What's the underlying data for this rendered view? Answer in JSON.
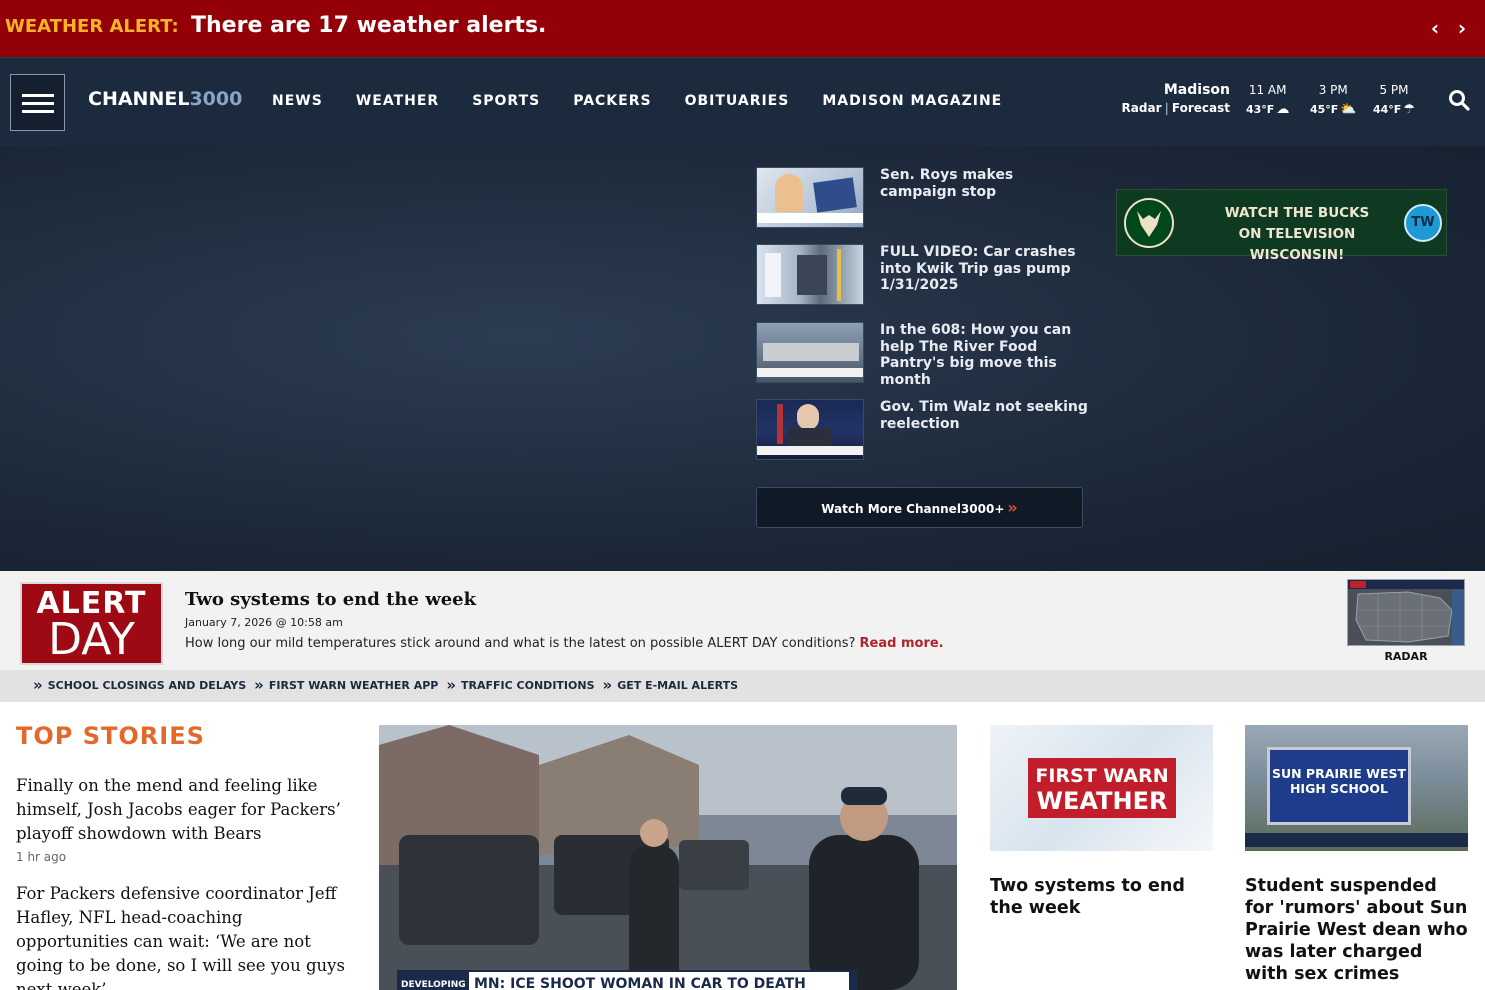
{
  "alert": {
    "label": "WEATHER ALERT:",
    "text": "There are 17 weather alerts.",
    "prev_icon": "‹",
    "next_icon": "›"
  },
  "nav": {
    "logo_part1": "CHANNEL",
    "logo_part2": "3000",
    "links": [
      "NEWS",
      "WEATHER",
      "SPORTS",
      "PACKERS",
      "OBITUARIES",
      "MADISON MAGAZINE"
    ],
    "weather": {
      "city": "Madison",
      "radar_link": "Radar",
      "forecast_link": "Forecast",
      "hours": [
        {
          "time": "11 AM",
          "temp": "43°F",
          "icon": "partly-cloudy-icon"
        },
        {
          "time": "3 PM",
          "temp": "45°F",
          "icon": "partly-sunny-icon"
        },
        {
          "time": "5 PM",
          "temp": "44°F",
          "icon": "rain-icon"
        }
      ]
    }
  },
  "videos": [
    {
      "title": "Sen. Roys makes campaign stop"
    },
    {
      "title": "FULL VIDEO: Car crashes into Kwik Trip gas pump 1/31/2025"
    },
    {
      "title": "In the 608: How you can help The River Food Pantry's big move this month"
    },
    {
      "title": "Gov. Tim Walz not seeking reelection"
    }
  ],
  "watch_more": {
    "label": "Watch More Channel3000+",
    "chevron": "»"
  },
  "ad": {
    "line1": "WATCH THE BUCKS",
    "line2": "ON TELEVISION WISCONSIN!",
    "badge": "TW"
  },
  "alertday": {
    "logo_line1": "ALERT",
    "logo_line2": "DAY",
    "title": "Two systems to end the week",
    "date": "January 7, 2026 @ 10:58 am",
    "desc": "How long our mild temperatures stick around and what is the latest on possible ALERT DAY conditions?",
    "read_more": "Read more.",
    "radar_label": "RADAR"
  },
  "quick_links": [
    "SCHOOL CLOSINGS AND DELAYS",
    "FIRST WARN WEATHER APP",
    "TRAFFIC CONDITIONS",
    "GET E-MAIL ALERTS"
  ],
  "top_stories": {
    "heading": "TOP STORIES",
    "items": [
      {
        "headline": "Finally on the mend and feeling like himself, Josh Jacobs eager for Packers’ playoff showdown with Bears",
        "time": "1 hr ago"
      },
      {
        "headline": "For Packers defensive coordinator Jeff Hafley, NFL head-coaching opportunities can wait: ‘We are not going to be done, so I will see you guys next week’",
        "time": ""
      }
    ]
  },
  "main_story": {
    "lower_third": "MN: ICE SHOOT WOMAN IN CAR TO DEATH",
    "tag": "DEVELOPING"
  },
  "cards": [
    {
      "title": "Two systems to end the week",
      "img_line1": "FIRST",
      "img_line2": "WARN",
      "img_line3": "WEATHER"
    },
    {
      "title": "Student suspended for 'rumors' about Sun Prairie West dean who was later charged with sex crimes",
      "img_line1": "SUN PRAIRIE WEST",
      "img_line2": "HIGH SCHOOL"
    }
  ]
}
